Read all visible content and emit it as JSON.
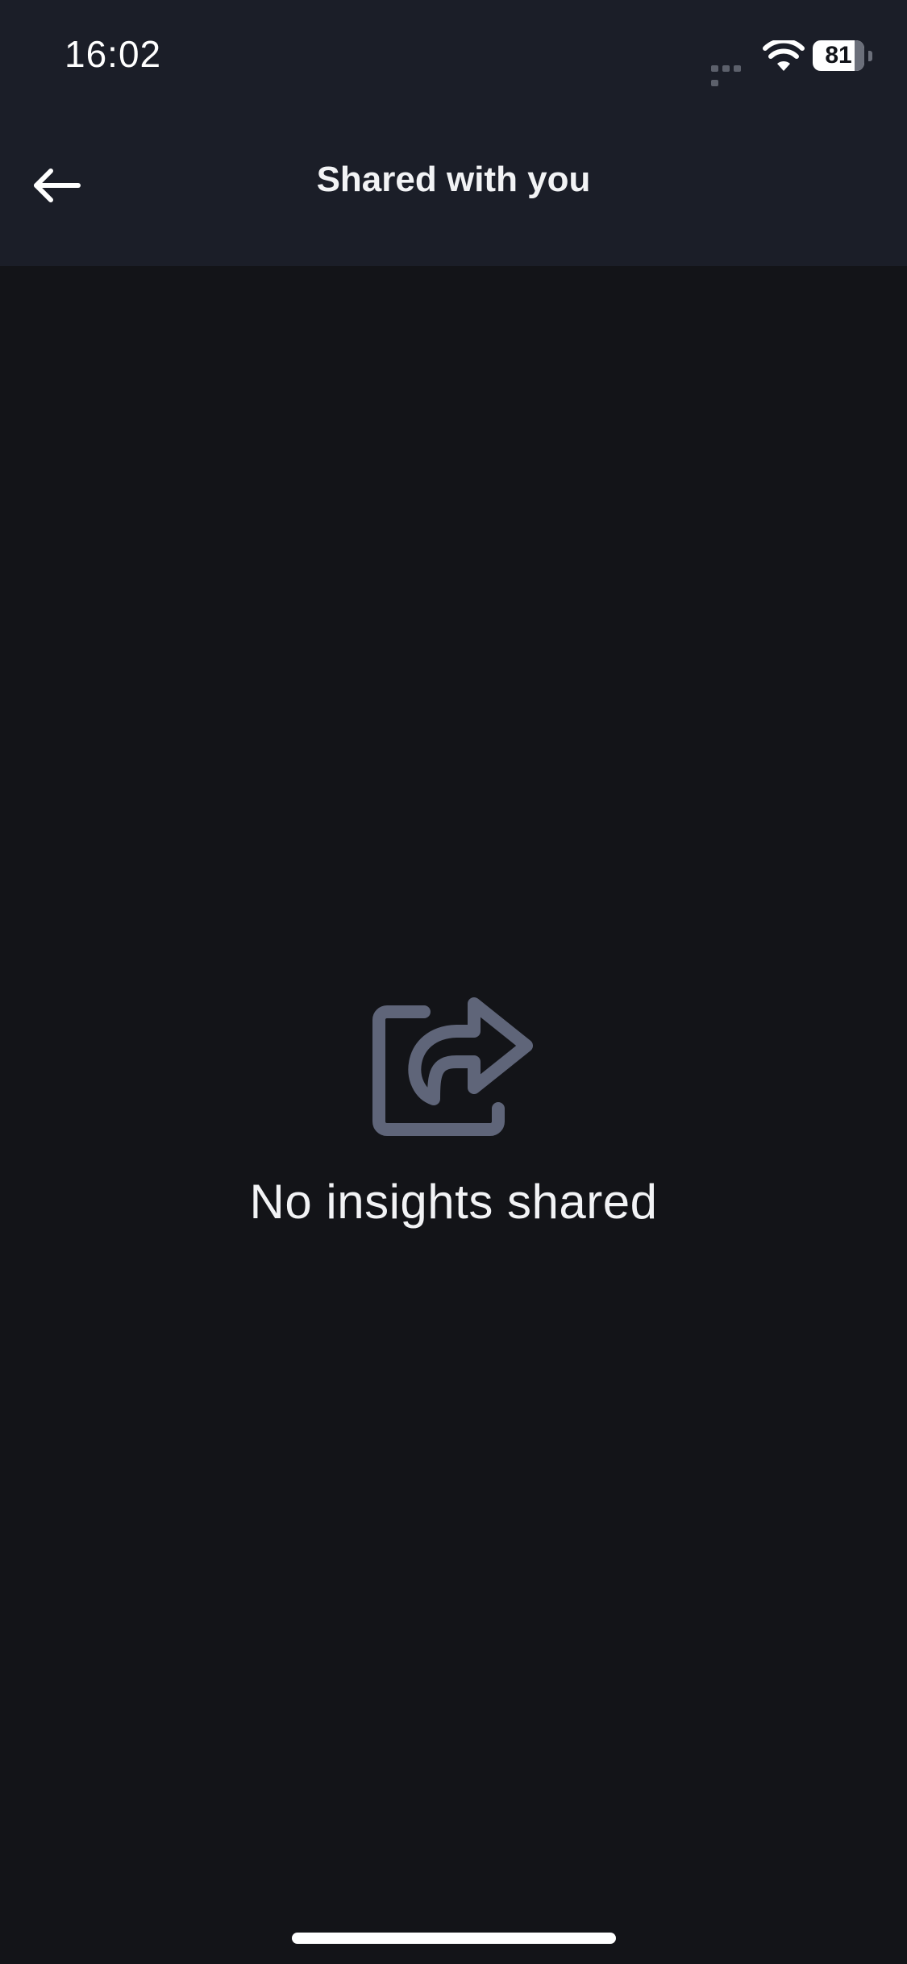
{
  "status_bar": {
    "time": "16:02",
    "battery_level": 81,
    "battery_label": "81"
  },
  "header": {
    "title": "Shared with you",
    "back_icon": "arrow-left-icon"
  },
  "empty_state": {
    "icon": "share-icon",
    "message": "No insights shared"
  },
  "colors": {
    "header_background": "#1b1e28",
    "page_background": "#131418",
    "icon_color": "#5f6579",
    "text_color": "#f2f3f5"
  }
}
